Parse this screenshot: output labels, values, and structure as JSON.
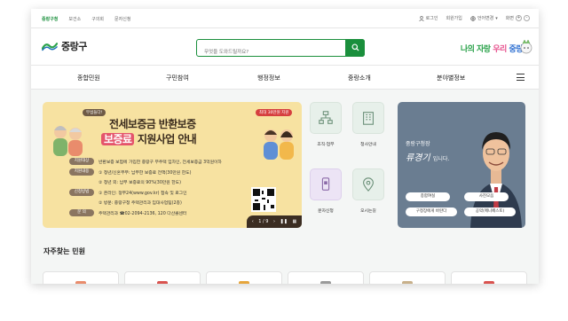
{
  "topbar": {
    "links": [
      "중랑구청",
      "보건소",
      "구의회",
      "문자신청"
    ],
    "login": "로그인",
    "signup": "회원가입",
    "language": "언어변경",
    "zoom_label": "화면",
    "zoom_in": "+",
    "zoom_out": "-"
  },
  "header": {
    "logo_text": "중랑구",
    "search_placeholder": "무엇을 도와드릴까요?",
    "slogan": {
      "part1": "나의 자랑",
      "part2": "우리",
      "part3": "중랑"
    }
  },
  "nav": {
    "items": [
      "종합민원",
      "구민참여",
      "행정정보",
      "중랑소개",
      "분야별정보"
    ]
  },
  "banner": {
    "tag_left": "무섭들다!",
    "tag_right": "최대 30만원 지원",
    "title_line1": "전세보증금 반환보증",
    "title_highlight": "보증료",
    "title_line2": "지원사업 안내",
    "rows": [
      {
        "label": "지원대상",
        "text": "반환보증 보험에 가입한 중랑구 무주택 임차인, 전세보증금 3억원이하"
      },
      {
        "label": "지원내용",
        "text": "① 청년/신혼부부: 납부한 보증료 전액(30만원 한도)"
      },
      {
        "label": "",
        "text": "② 청년 외: 납부 보증료의 90%(30만원 한도)"
      },
      {
        "label": "신청방법",
        "text": "① 온라인: 정부24(www.gov.kr) 접속 및 로그인"
      },
      {
        "label": "",
        "text": "② 방문: 중랑구청 주택관리과 임대사업팀(2층)"
      },
      {
        "label": "문 의",
        "text": "주택관리과 ☎02-2094-2136, 120 다산콜센터"
      }
    ],
    "pager": "1 / 9"
  },
  "quick_menu": [
    {
      "label": "조직·업무",
      "icon": "org-chart-icon"
    },
    {
      "label": "청사안내",
      "icon": "building-icon"
    },
    {
      "label": "문자신청",
      "icon": "phone-icon"
    },
    {
      "label": "오시는길",
      "icon": "location-icon"
    }
  ],
  "mayor": {
    "title": "중랑구청장",
    "name": "류경기",
    "suffix": "입니다.",
    "buttons": [
      "종합여실",
      "사진모음",
      "구청장에게 바란다",
      "공약(매니페스토)"
    ]
  },
  "frequent": {
    "title": "자주찾는 민원"
  },
  "colors": {
    "primary_green": "#1a8f3c",
    "banner_bg": "#f7e2a1",
    "highlight_red": "#e4546b",
    "mayor_bg": "#6a7d91"
  }
}
